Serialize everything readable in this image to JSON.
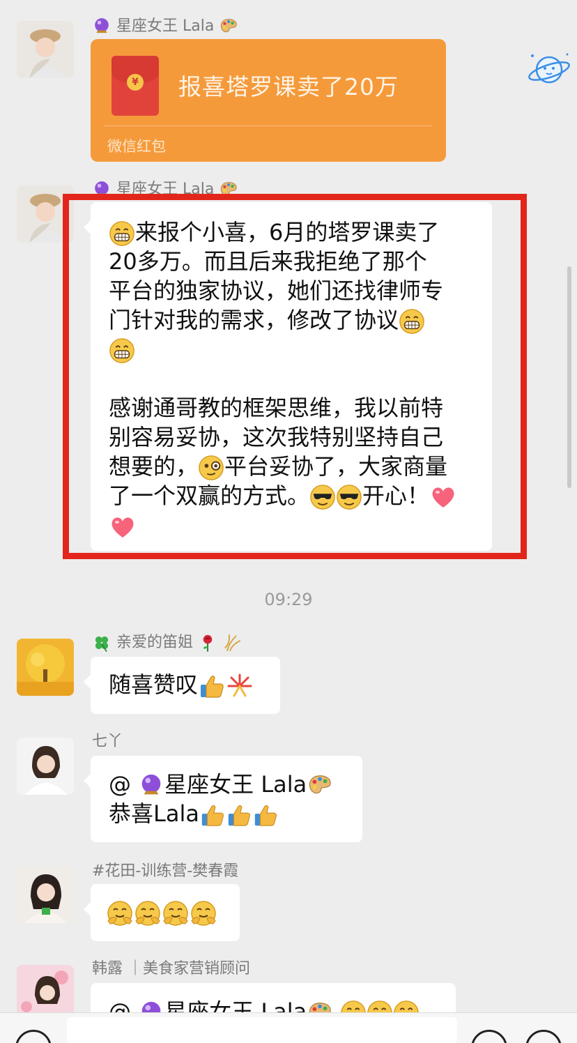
{
  "messages": [
    {
      "sender": "星座女王 Lala",
      "type": "red_packet",
      "red_packet": {
        "title": "报喜塔罗课卖了20万",
        "footer": "微信红包"
      }
    },
    {
      "sender": "星座女王 Lala",
      "type": "text",
      "lines": [
        "来报个小喜，6月的塔罗课卖了",
        "20多万。而且后来我拒绝了那个",
        "平台的独家协议，她们还找律师专",
        "门针对我的需求，修改了协议",
        "",
        "",
        "感谢通哥教的框架思维，我以前特",
        "别容易妥协，这次我特别坚持自己",
        "想要的，",
        "平台妥协了，大家商量",
        "了一个双赢的方式。",
        "开心！"
      ]
    },
    {
      "timestamp": "09:29"
    },
    {
      "sender": "亲爱的笛姐",
      "type": "text",
      "lines": [
        "随喜赞叹"
      ]
    },
    {
      "sender": "七丫",
      "type": "text",
      "lines": [
        "@",
        "星座女王 Lala",
        "恭喜Lala"
      ]
    },
    {
      "sender": "#花田-训练营-樊春霞",
      "type": "text",
      "lines": []
    },
    {
      "sender": "韩露 ｜美食家营销顾问",
      "type": "text",
      "lines": [
        "@",
        "星座女王 Lala"
      ]
    }
  ],
  "icons": {
    "coin_symbol": "¥",
    "planet_sticker": "planet-icon"
  },
  "colors": {
    "red_packet": "#f59a3b",
    "highlight": "#e3261b",
    "background": "#ededed"
  }
}
